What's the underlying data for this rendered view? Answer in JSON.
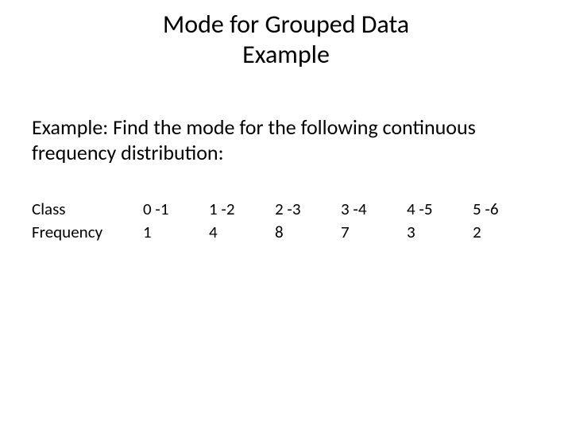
{
  "title_line1": "Mode for Grouped Data",
  "title_line2": "Example",
  "body": "Example: Find the mode for the following continuous frequency distribution:",
  "row_labels": {
    "class": "Class",
    "frequency": "Frequency"
  },
  "table": [
    {
      "class": "0 -1",
      "freq": "1"
    },
    {
      "class": "1 -2",
      "freq": "4"
    },
    {
      "class": "2 -3",
      "freq": "8"
    },
    {
      "class": "3 -4",
      "freq": "7"
    },
    {
      "class": "4 -5",
      "freq": "3"
    },
    {
      "class": "5 -6",
      "freq": "2"
    }
  ]
}
